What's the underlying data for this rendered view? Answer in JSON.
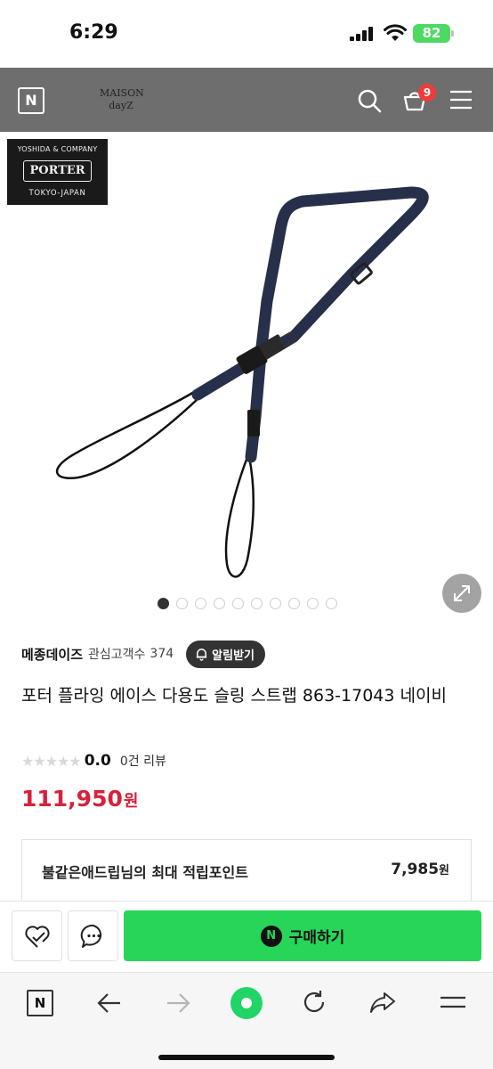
{
  "status_bar": {
    "time": "6:29",
    "battery": "82"
  },
  "header": {
    "logo_letter": "N",
    "brand_line1": "MAISON",
    "brand_line2": "dayZ",
    "cart_count": "9"
  },
  "product_image": {
    "logo": {
      "line1": "YOSHIDA & COMPANY",
      "line2": "PORTER",
      "line3": "TOKYO-JAPAN"
    },
    "slide_count": 10,
    "active_slide": 1
  },
  "seller": {
    "name": "메종데이즈",
    "interest_label": "관심고객수",
    "interest_count": "374",
    "alarm_button": "알림받기"
  },
  "product": {
    "title": "포터 플라잉 에이스 다용도 슬링 스트랩 863-17043 네이비",
    "rating": "0.0",
    "review_count": "0건 리뷰",
    "price": "111,950",
    "price_unit": "원"
  },
  "points": {
    "label": "불같은애드립님의 최대 적립포인트",
    "value": "7,985",
    "unit": "원"
  },
  "actions": {
    "buy_button": "구매하기",
    "buy_logo": "N"
  },
  "browser": {
    "home_letter": "N"
  },
  "colors": {
    "header_bg": "#6e6e6e",
    "price_red": "#d8203b",
    "buy_green": "#27d559",
    "badge_red": "#ef3b3b"
  }
}
